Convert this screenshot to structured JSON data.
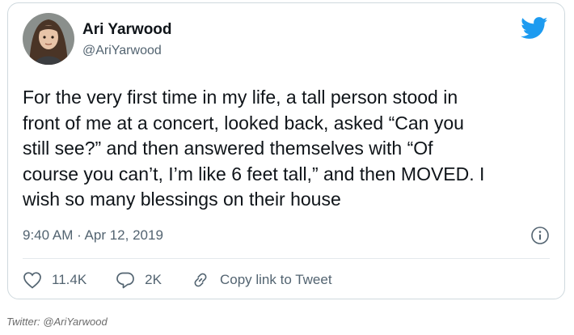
{
  "author": {
    "name": "Ari Yarwood",
    "handle": "@AriYarwood"
  },
  "tweet": {
    "text": "For the very first time in my life, a tall person stood in\nfront of me at a concert, looked back, asked “Can you\nstill see?” and then answered themselves with “Of\ncourse you can’t, I’m like 6 feet tall,” and then MOVED. I\nwish so many blessings on their house",
    "timestamp": "9:40 AM · Apr 12, 2019"
  },
  "actions": {
    "like_count": "11.4K",
    "reply_count": "2K",
    "copy_link_label": "Copy link to Tweet"
  },
  "icons": {
    "brand": "twitter-bird-icon",
    "info": "info-icon",
    "like": "heart-icon",
    "reply": "reply-bubble-icon",
    "link": "link-icon"
  },
  "colors": {
    "brand": "#1d9bf0",
    "text": "#0f1419",
    "secondary": "#536471",
    "border": "#cfd9de"
  },
  "footer": {
    "credit": "Twitter: @AriYarwood"
  }
}
